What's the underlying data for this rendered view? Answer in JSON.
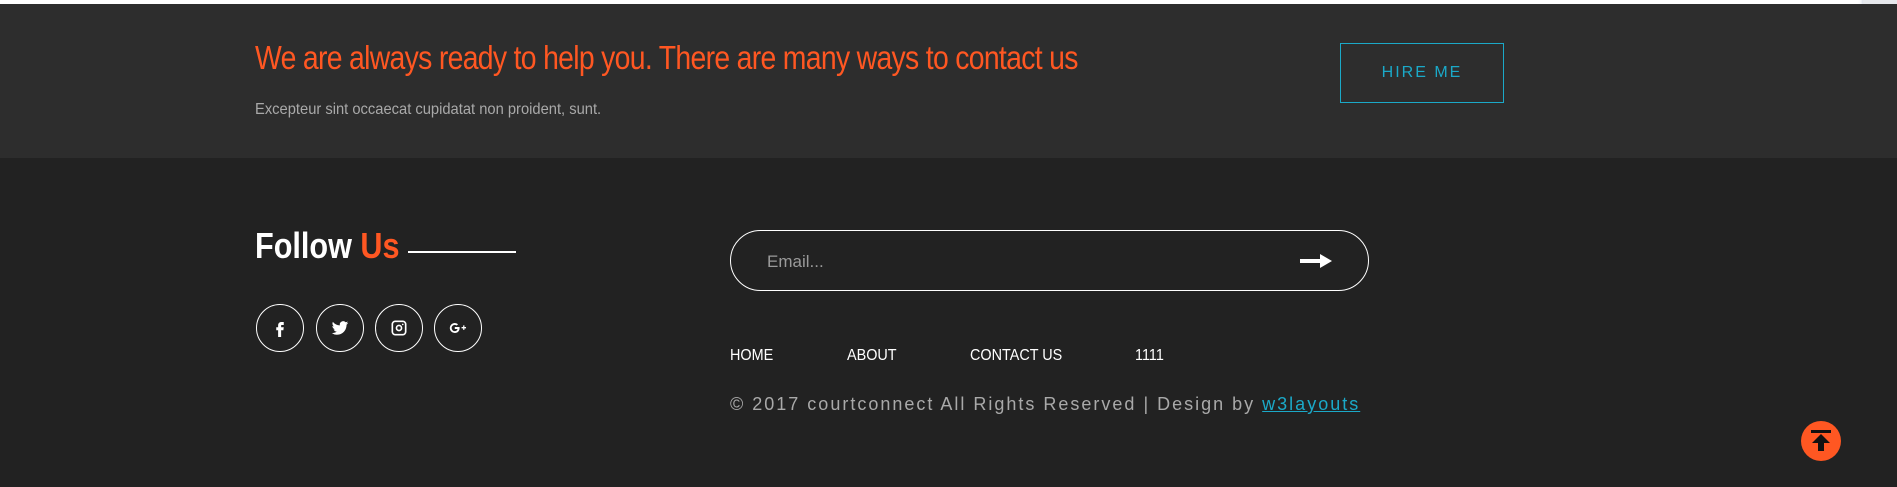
{
  "cta": {
    "title": "We are always ready to help you. There are many ways to contact us",
    "subtitle": "Excepteur sint occaecat cupidatat non proident, sunt.",
    "button_label": "HIRE ME"
  },
  "follow": {
    "title_main": "Follow",
    "title_accent": "Us",
    "social_icons": [
      "facebook-icon",
      "twitter-icon",
      "instagram-icon",
      "google-plus-icon"
    ]
  },
  "subscribe": {
    "placeholder": "Email...",
    "value": ""
  },
  "nav": {
    "items": [
      "HOME",
      "ABOUT",
      "CONTACT US",
      "1111"
    ]
  },
  "footer": {
    "copyright_prefix": "© 2017 courtconnect All Rights Reserved | Design by ",
    "designer_link": "w3layouts"
  },
  "colors": {
    "accent": "#ff5722",
    "link": "#1ba9c8",
    "background": "#222222",
    "cta_background": "#2d2d2d"
  }
}
